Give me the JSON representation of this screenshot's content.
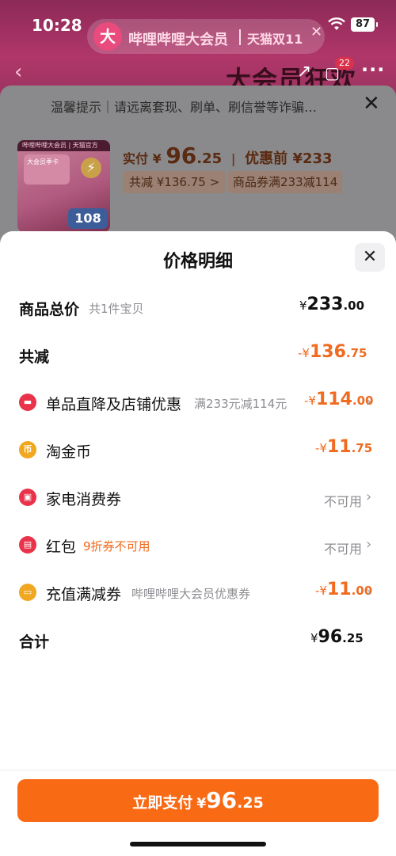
{
  "status_bar": {
    "time": "10:28",
    "battery": "87"
  },
  "header": {
    "logo_char": "大",
    "brand_title": "哔哩哔哩大会员",
    "tag": "天猫双11",
    "close_glyph": "✕",
    "banner_text": "大会员狂欢",
    "cart_badge": "22"
  },
  "notice": {
    "text": "温馨提示｜请远离套现、刷单、刷信誉等诈骗…"
  },
  "product": {
    "image_labels": {
      "head": "哔哩哔哩大会员 | 天猫官方",
      "card": "大会员季卡",
      "badge": "108"
    },
    "paid_label": "实付",
    "paid_symbol": "¥",
    "paid_int": "96",
    "paid_dec": ".25",
    "before_text": "优惠前 ¥233",
    "total_discount_chip": "共减 ¥136.75 >",
    "coupon_chip": "商品券满233减114"
  },
  "detail": {
    "title": "价格明细",
    "rows": [
      {
        "title": "商品总价",
        "sub": "共1件宝贝",
        "sym": "¥",
        "int": "233",
        "dec": ".00"
      },
      {
        "title": "共减",
        "sym": "-¥",
        "int": "136",
        "dec": ".75"
      },
      {
        "title": "单品直降及店铺优惠",
        "sub": "满233元减114元",
        "sym": "-¥",
        "int": "114",
        "dec": ".00"
      },
      {
        "title": "淘金币",
        "sym": "-¥",
        "int": "11",
        "dec": ".75"
      },
      {
        "title": "家电消费券",
        "status": "不可用"
      },
      {
        "title": "红包",
        "sub": "9折券不可用",
        "status": "不可用"
      },
      {
        "title": "充值满减券",
        "sub": "哔哩哔哩大会员优惠券",
        "sym": "-¥",
        "int": "11",
        "dec": ".00"
      },
      {
        "title": "合计",
        "sym": "¥",
        "int": "96",
        "dec": ".25"
      }
    ]
  },
  "pay_button": {
    "label": "立即支付",
    "sym": "¥",
    "int": "96",
    "dec": ".25"
  },
  "colors": {
    "accent_orange": "#f96a14",
    "price_orange": "#f06a1f",
    "icon_red": "#e8334a",
    "icon_gold": "#f1a71f"
  },
  "icons": {
    "shop_discount": "shop-icon",
    "coins": "coin-icon",
    "appliance": "voucher-icon",
    "red_packet": "red-packet-icon",
    "recharge": "recharge-icon"
  }
}
